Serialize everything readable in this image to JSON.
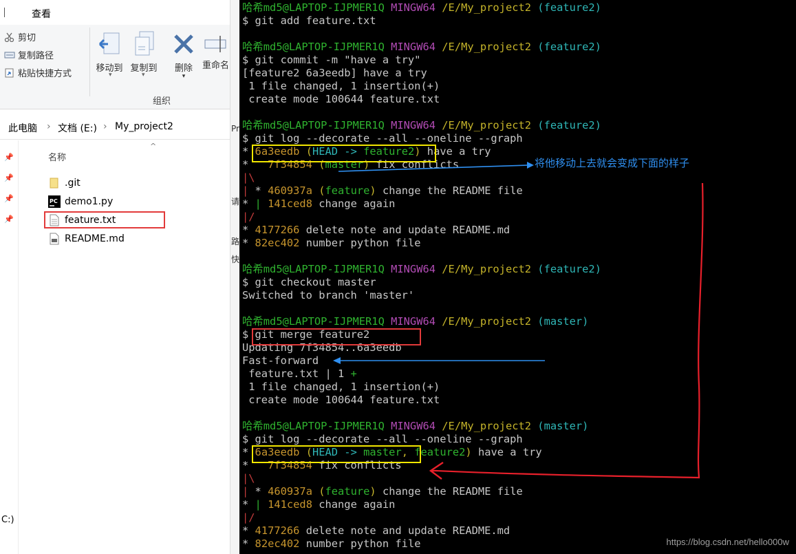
{
  "explorer": {
    "tab_view": "查看",
    "ribbon": {
      "cut": "剪切",
      "copy_path": "复制路径",
      "paste_shortcut": "粘贴快捷方式",
      "move_to": "移动到",
      "copy_to": "复制到",
      "delete": "删除",
      "rename": "重命名",
      "group_organize": "组织"
    },
    "address": [
      "此电脑",
      "文档 (E:)",
      "My_project2"
    ],
    "column_name": "名称",
    "files": [
      ".git",
      "demo1.py",
      "feature.txt",
      "README.md"
    ],
    "drive_stub": "C:)",
    "clipped_text": [
      "Pr",
      "请",
      "路",
      "快"
    ]
  },
  "terminal": {
    "prompt": {
      "user": "哈希md5@LAPTOP-IJPMER1Q",
      "system": "MINGW64",
      "path": "/E/My_project2"
    },
    "lines": [
      {
        "t": "prompt",
        "branch": "(feature2)"
      },
      {
        "t": "text",
        "text": "$ git add feature.txt"
      },
      {
        "t": "blank"
      },
      {
        "t": "prompt",
        "branch": "(feature2)"
      },
      {
        "t": "text",
        "text": "$ git commit -m \"have a try\""
      },
      {
        "t": "text",
        "text": "[feature2 6a3eedb] have a try"
      },
      {
        "t": "text",
        "text": " 1 file changed, 1 insertion(+)"
      },
      {
        "t": "text",
        "text": " create mode 100644 feature.txt"
      },
      {
        "t": "blank"
      },
      {
        "t": "prompt",
        "branch": "(feature2)"
      },
      {
        "t": "text",
        "text": "$ git log --decorate --all --oneline --graph"
      },
      {
        "t": "seg",
        "segs": [
          [
            "* ",
            "gray"
          ],
          [
            "6a3eedb ",
            "orange"
          ],
          [
            "(",
            "yellow"
          ],
          [
            "HEAD -> ",
            "cyan"
          ],
          [
            "feature2",
            "green"
          ],
          [
            ")",
            "yellow"
          ],
          [
            " have a try",
            "gray"
          ]
        ]
      },
      {
        "t": "seg",
        "segs": [
          [
            "*   ",
            "gray"
          ],
          [
            "7f34854 ",
            "orange"
          ],
          [
            "(",
            "yellow"
          ],
          [
            "master",
            "green"
          ],
          [
            ")",
            "yellow"
          ],
          [
            " fix conflicts",
            "gray"
          ]
        ]
      },
      {
        "t": "seg",
        "segs": [
          [
            "|\\",
            "red"
          ]
        ]
      },
      {
        "t": "seg",
        "segs": [
          [
            "| ",
            "red"
          ],
          [
            "* ",
            "gray"
          ],
          [
            "460937a ",
            "orange"
          ],
          [
            "(",
            "yellow"
          ],
          [
            "feature",
            "green"
          ],
          [
            ")",
            "yellow"
          ],
          [
            " change the README file",
            "gray"
          ]
        ]
      },
      {
        "t": "seg",
        "segs": [
          [
            "* ",
            "gray"
          ],
          [
            "| ",
            "green"
          ],
          [
            "141ced8 ",
            "orange"
          ],
          [
            "change again",
            "gray"
          ]
        ]
      },
      {
        "t": "seg",
        "segs": [
          [
            "|/",
            "red"
          ]
        ]
      },
      {
        "t": "seg",
        "segs": [
          [
            "* ",
            "gray"
          ],
          [
            "4177266 ",
            "orange"
          ],
          [
            "delete note and update README.md",
            "gray"
          ]
        ]
      },
      {
        "t": "seg",
        "segs": [
          [
            "* ",
            "gray"
          ],
          [
            "82ec402 ",
            "orange"
          ],
          [
            "number python file",
            "gray"
          ]
        ]
      },
      {
        "t": "blank"
      },
      {
        "t": "prompt",
        "branch": "(feature2)"
      },
      {
        "t": "text",
        "text": "$ git checkout master"
      },
      {
        "t": "text",
        "text": "Switched to branch 'master'"
      },
      {
        "t": "blank"
      },
      {
        "t": "prompt",
        "branch": "(master)"
      },
      {
        "t": "text",
        "text": "$ git merge feature2"
      },
      {
        "t": "text",
        "text": "Updating 7f34854..6a3eedb"
      },
      {
        "t": "text",
        "text": "Fast-forward"
      },
      {
        "t": "seg",
        "segs": [
          [
            " feature.txt | 1 ",
            "gray"
          ],
          [
            "+",
            "green"
          ]
        ]
      },
      {
        "t": "text",
        "text": " 1 file changed, 1 insertion(+)"
      },
      {
        "t": "text",
        "text": " create mode 100644 feature.txt"
      },
      {
        "t": "blank"
      },
      {
        "t": "prompt",
        "branch": "(master)"
      },
      {
        "t": "text",
        "text": "$ git log --decorate --all --oneline --graph"
      },
      {
        "t": "seg",
        "segs": [
          [
            "* ",
            "gray"
          ],
          [
            "6a3eedb ",
            "orange"
          ],
          [
            "(",
            "yellow"
          ],
          [
            "HEAD -> ",
            "cyan"
          ],
          [
            "master",
            "green"
          ],
          [
            ", ",
            "yellow"
          ],
          [
            "feature2",
            "green"
          ],
          [
            ")",
            "yellow"
          ],
          [
            " have a try",
            "gray"
          ]
        ]
      },
      {
        "t": "seg",
        "segs": [
          [
            "*   ",
            "gray"
          ],
          [
            "7f34854 ",
            "orange"
          ],
          [
            "fix conflicts",
            "gray"
          ]
        ]
      },
      {
        "t": "seg",
        "segs": [
          [
            "|\\",
            "red"
          ]
        ]
      },
      {
        "t": "seg",
        "segs": [
          [
            "| ",
            "red"
          ],
          [
            "* ",
            "gray"
          ],
          [
            "460937a ",
            "orange"
          ],
          [
            "(",
            "yellow"
          ],
          [
            "feature",
            "green"
          ],
          [
            ")",
            "yellow"
          ],
          [
            " change the README file",
            "gray"
          ]
        ]
      },
      {
        "t": "seg",
        "segs": [
          [
            "* ",
            "gray"
          ],
          [
            "| ",
            "green"
          ],
          [
            "141ced8 ",
            "orange"
          ],
          [
            "change again",
            "gray"
          ]
        ]
      },
      {
        "t": "seg",
        "segs": [
          [
            "|/",
            "red"
          ]
        ]
      },
      {
        "t": "seg",
        "segs": [
          [
            "* ",
            "gray"
          ],
          [
            "4177266 ",
            "orange"
          ],
          [
            "delete note and update README.md",
            "gray"
          ]
        ]
      },
      {
        "t": "seg",
        "segs": [
          [
            "* ",
            "gray"
          ],
          [
            "82ec402 ",
            "orange"
          ],
          [
            "number python file",
            "gray"
          ]
        ]
      }
    ],
    "annotation": "将他移动上去就会变成下面的样子",
    "watermark": "https://blog.csdn.net/hello000w"
  },
  "colors": {
    "green": "#2fb32f",
    "purple": "#b14bb4",
    "yellow": "#c5b42a",
    "cyan": "#2fb7b7",
    "orange": "#c7952d",
    "red": "#c03b3b",
    "gray": "#c8c8c8",
    "highlight_yellow": "#f2e700",
    "highlight_red": "#e23a3a",
    "annotation_blue": "#2f8ff0"
  },
  "icons": [
    "scissors-icon",
    "copy-path-icon",
    "paste-shortcut-icon",
    "move-to-icon",
    "copy-to-icon",
    "delete-icon",
    "rename-icon",
    "folder-icon",
    "pycharm-icon",
    "text-file-icon",
    "markdown-file-icon",
    "pin-icon"
  ]
}
